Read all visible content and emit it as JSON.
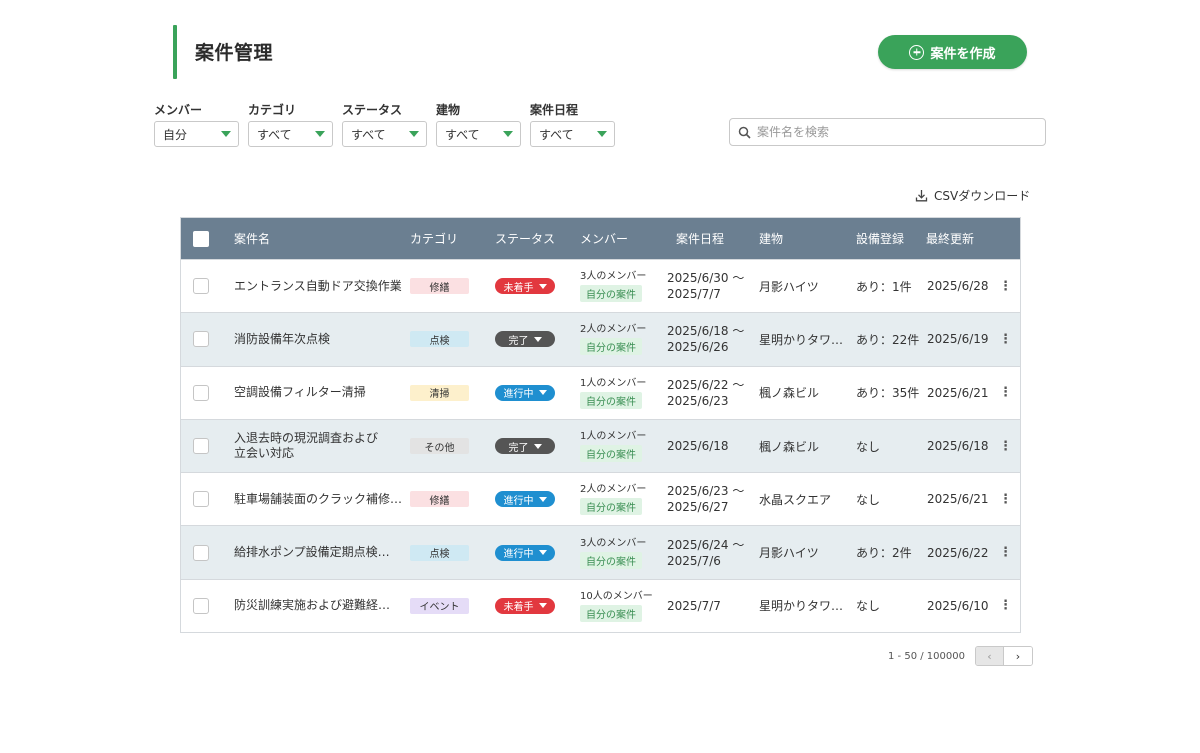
{
  "header": {
    "title": "案件管理",
    "create_label": "案件を作成"
  },
  "filters": [
    {
      "label": "メンバー",
      "value": "自分"
    },
    {
      "label": "カテゴリ",
      "value": "すべて"
    },
    {
      "label": "ステータス",
      "value": "すべて"
    },
    {
      "label": "建物",
      "value": "すべて"
    },
    {
      "label": "案件日程",
      "value": "すべて"
    }
  ],
  "search": {
    "placeholder": "案件名を検索"
  },
  "csv_label": "CSVダウンロード",
  "table": {
    "headers": [
      "案件名",
      "カテゴリ",
      "ステータス",
      "メンバー",
      "案件日程",
      "建物",
      "設備登録",
      "最終更新"
    ],
    "rows": [
      {
        "name": "エントランス自動ドア交換作業",
        "category": "修繕",
        "status": "未着手",
        "members": "3人のメンバー",
        "tag": "自分の案件",
        "date1": "2025/6/30 〜",
        "date2": "2025/7/7",
        "building": "月影ハイツ",
        "equipment": "あり：1件",
        "updated": "2025/6/28"
      },
      {
        "name": "消防設備年次点検",
        "category": "点検",
        "status": "完了",
        "members": "2人のメンバー",
        "tag": "自分の案件",
        "date1": "2025/6/18 〜",
        "date2": "2025/6/26",
        "building": "星明かりタワ…",
        "equipment": "あり：22件",
        "updated": "2025/6/19"
      },
      {
        "name": "空調設備フィルター清掃",
        "category": "清掃",
        "status": "進行中",
        "members": "1人のメンバー",
        "tag": "自分の案件",
        "date1": "2025/6/22 〜",
        "date2": "2025/6/23",
        "building": "楓ノ森ビル",
        "equipment": "あり：35件",
        "updated": "2025/6/21"
      },
      {
        "name": "入退去時の現況調査および立会い対応",
        "category": "その他",
        "status": "完了",
        "members": "1人のメンバー",
        "tag": "自分の案件",
        "date1": "2025/6/18",
        "date2": "",
        "building": "楓ノ森ビル",
        "equipment": "なし",
        "updated": "2025/6/18"
      },
      {
        "name": "駐車場舗装面のクラック補修…",
        "category": "修繕",
        "status": "進行中",
        "members": "2人のメンバー",
        "tag": "自分の案件",
        "date1": "2025/6/23 〜",
        "date2": "2025/6/27",
        "building": "水晶スクエア",
        "equipment": "なし",
        "updated": "2025/6/21"
      },
      {
        "name": "給排水ポンプ設備定期点検…",
        "category": "点検",
        "status": "進行中",
        "members": "3人のメンバー",
        "tag": "自分の案件",
        "date1": "2025/6/24 〜",
        "date2": "2025/7/6",
        "building": "月影ハイツ",
        "equipment": "あり：2件",
        "updated": "2025/6/22"
      },
      {
        "name": "防災訓練実施および避難経…",
        "category": "イベント",
        "status": "未着手",
        "members": "10人のメンバー",
        "tag": "自分の案件",
        "date1": "2025/7/7",
        "date2": "",
        "building": "星明かりタワ…",
        "equipment": "なし",
        "updated": "2025/6/10"
      }
    ]
  },
  "pagination": {
    "range": "1 - 50 / 100000",
    "prev": "‹",
    "next": "›"
  },
  "colors": {
    "accent": "#3aa35a",
    "header_bg": "#6b7f91",
    "cat_修繕": "#fbe0e2",
    "cat_点検": "#cfe9f3",
    "cat_清掃": "#fdf0cc",
    "cat_その他": "#e3e3e3",
    "cat_イベント": "#e5dcf7",
    "status_未着手": "#e2383f",
    "status_完了": "#555555",
    "status_進行中": "#1f8fd0"
  }
}
